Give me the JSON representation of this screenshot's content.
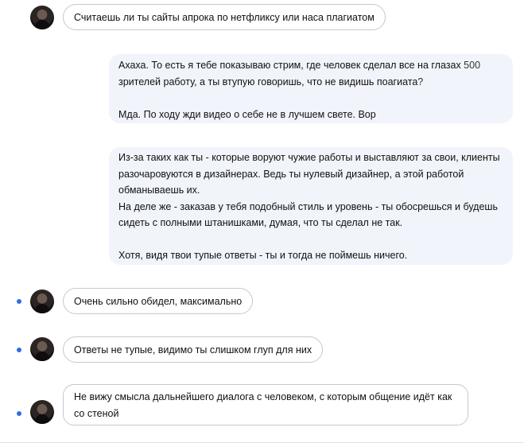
{
  "messages": {
    "m1": {
      "text": "Считаешь ли ты сайты апрока по нетфликсу или наса плагиатом"
    },
    "m2": {
      "line1_a": "Ахаха. То есть я тебе показываю стрим, где человек сделал все на глазах ",
      "line1_b": "500",
      "line2_a": "зрителей работу, а ты втупую говоришь, что не видишь поагиата",
      "line2_b": "?",
      "line3": "Мда. По ходу жди видео о себе не в лучшем свете. Вор"
    },
    "m3": {
      "p1": "Из-за таких как ты - которые воруют чужие работы и выставляют за свои, клиенты разочаровуются в дизайнерах. Ведь ты нулевый дизайнер, а этой работой обманываешь их.",
      "p2": "На деле же - заказав у тебя подобный стиль и уровень - ты обосрешься и будешь сидеть с полными штанишками, думая, что ты сделал не так.",
      "p3": "Хотя, видя твои тупые ответы - ты и тогда не поймешь ничего."
    },
    "m4": {
      "text": "Очень сильно обидел, максимально"
    },
    "m5": {
      "text": "Ответы не тупые, видимо ты слишком глуп для них"
    },
    "m6": {
      "text": "Не вижу смысла дальнейшего диалога с человеком, с которым общение идёт как со стеной"
    }
  },
  "colors": {
    "outgoing_bubble": "#f1f4fb",
    "incoming_border": "#c8c8c8",
    "unread_dot": "#2f6fe4"
  }
}
